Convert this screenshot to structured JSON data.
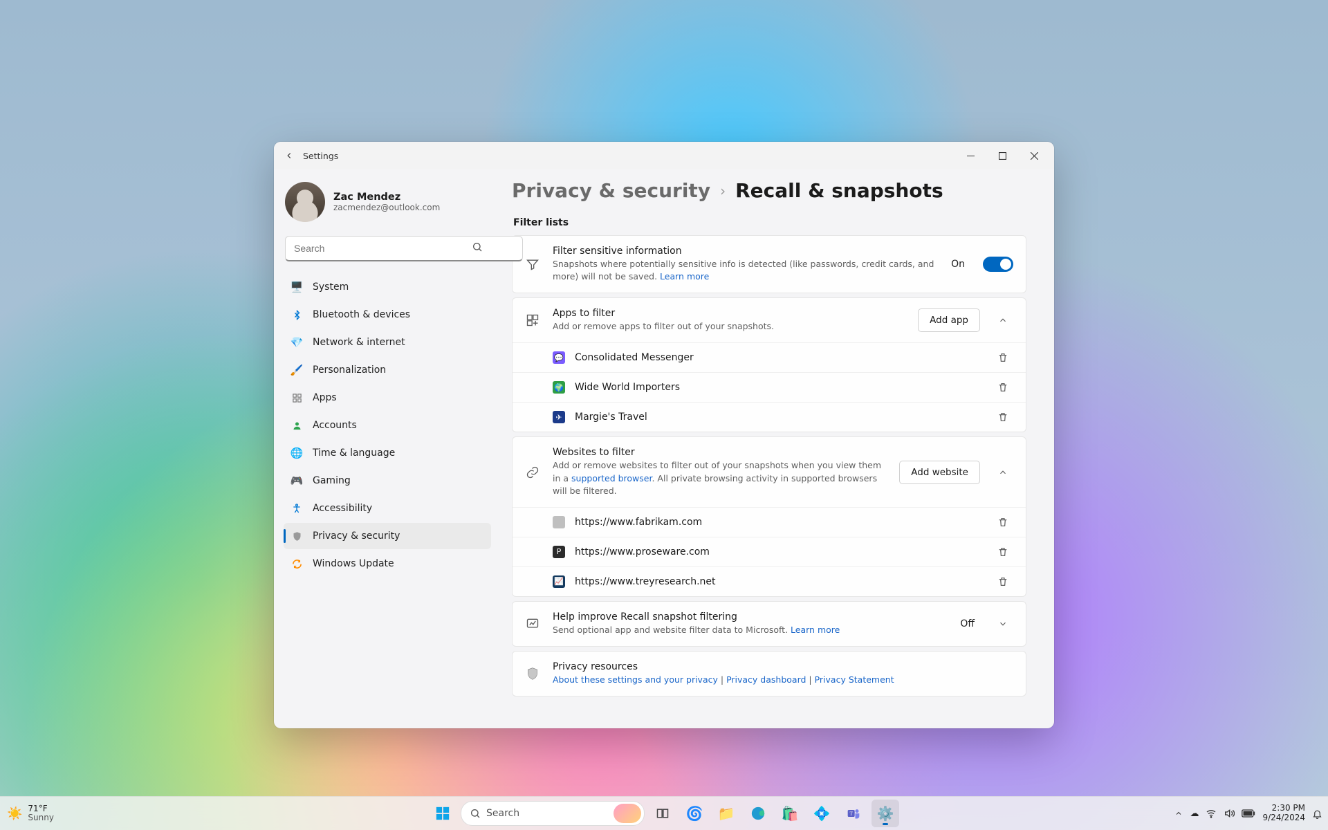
{
  "window": {
    "title": "Settings"
  },
  "user": {
    "name": "Zac Mendez",
    "email": "zacmendez@outlook.com"
  },
  "search": {
    "placeholder": "Search"
  },
  "nav": [
    {
      "label": "System",
      "icon_color": "#0078d4"
    },
    {
      "label": "Bluetooth & devices",
      "icon_color": "#0078d4"
    },
    {
      "label": "Network & internet",
      "icon_color": "#00a6d6"
    },
    {
      "label": "Personalization",
      "icon_color": "#e06b38"
    },
    {
      "label": "Apps",
      "icon_color": "#7a7a7a"
    },
    {
      "label": "Accounts",
      "icon_color": "#2ea44f"
    },
    {
      "label": "Time & language",
      "icon_color": "#3a9bd9"
    },
    {
      "label": "Gaming",
      "icon_color": "#8a8a8a"
    },
    {
      "label": "Accessibility",
      "icon_color": "#0078d4"
    },
    {
      "label": "Privacy & security",
      "icon_color": "#8a8a8a"
    },
    {
      "label": "Windows Update",
      "icon_color": "#ff8c00"
    }
  ],
  "nav_active_index": 9,
  "breadcrumb": {
    "parent": "Privacy & security",
    "current": "Recall & snapshots"
  },
  "section": {
    "title": "Filter lists"
  },
  "filter_sensitive": {
    "title": "Filter sensitive information",
    "desc": "Snapshots where potentially sensitive info is detected (like passwords, credit cards, and more) will not be saved.",
    "learn_more": "Learn more",
    "state_label": "On",
    "state": true
  },
  "apps_filter": {
    "title": "Apps to filter",
    "desc": "Add or remove apps to filter out of your snapshots.",
    "add_label": "Add app",
    "expanded": true,
    "items": [
      {
        "name": "Consolidated Messenger",
        "icon_bg": "#7a5cff"
      },
      {
        "name": "Wide World Importers",
        "icon_bg": "#2e9e44"
      },
      {
        "name": "Margie's Travel",
        "icon_bg": "#1b3a8a"
      }
    ]
  },
  "sites_filter": {
    "title": "Websites to filter",
    "desc_pre": "Add or remove websites to filter out of your snapshots when you view them in a ",
    "desc_link": "supported browser",
    "desc_post": ". All private browsing activity in supported browsers will be filtered.",
    "add_label": "Add website",
    "expanded": true,
    "items": [
      {
        "url": "https://www.fabrikam.com",
        "icon_bg": "#bfbfbf"
      },
      {
        "url": "https://www.proseware.com",
        "icon_bg": "#2b2b2b"
      },
      {
        "url": "https://www.treyresearch.net",
        "icon_bg": "#143a5f"
      }
    ]
  },
  "improve": {
    "title": "Help improve Recall snapshot filtering",
    "desc": "Send optional app and website filter data to Microsoft.",
    "learn_more": "Learn more",
    "state_label": "Off"
  },
  "resources": {
    "title": "Privacy resources",
    "links": [
      "About these settings and your privacy",
      "Privacy dashboard",
      "Privacy Statement"
    ],
    "separator": " | "
  },
  "taskbar": {
    "weather": {
      "temp": "71°F",
      "cond": "Sunny"
    },
    "search_placeholder": "Search",
    "clock": {
      "time": "2:30 PM",
      "date": "9/24/2024"
    }
  }
}
